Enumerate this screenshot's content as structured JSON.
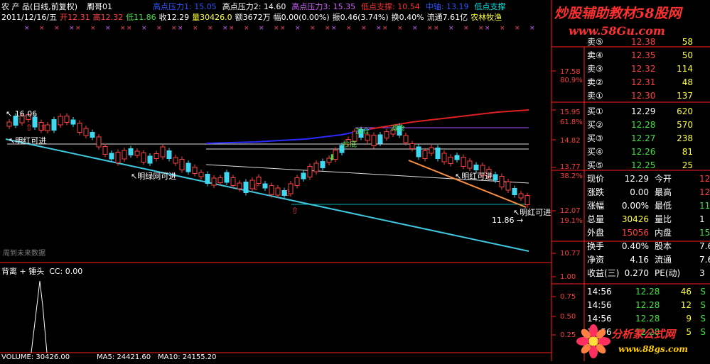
{
  "header": {
    "row1_left": "农 产 品(日线,前复权)",
    "indicator_name": "周哥01",
    "overlay_labels": [
      {
        "text": "高点压力1: 15.05",
        "color": "#2a55ff"
      },
      {
        "text": "高点压力2: 14.60",
        "color": "#ffffff"
      },
      {
        "text": "高点压力3: 15.35",
        "color": "#d060ff"
      },
      {
        "text": "低点支撑: 10.54",
        "color": "#ff3030"
      },
      {
        "text": "中轴: 13.19",
        "color": "#2a55ff"
      },
      {
        "text": "低点支撑",
        "color": "#00e5e5"
      }
    ],
    "row2": [
      {
        "text": "2011/12/16/五",
        "color": "#ffffff"
      },
      {
        "text": "开12.31",
        "color": "#ff4040"
      },
      {
        "text": "高12.32",
        "color": "#ff4040"
      },
      {
        "text": "低11.86",
        "color": "#40e040"
      },
      {
        "text": "收12.29",
        "color": "#ffffff"
      },
      {
        "text": "量30426.0",
        "color": "#ffff40"
      },
      {
        "text": "额3672万",
        "color": "#ffffff"
      },
      {
        "text": "幅0.00(0.00%)",
        "color": "#ffffff"
      },
      {
        "text": "振0.46(3.74%)",
        "color": "#ffffff"
      },
      {
        "text": "换0.40%",
        "color": "#ffffff"
      },
      {
        "text": "流通7.61亿",
        "color": "#ffffff"
      },
      {
        "text": "农林牧渔",
        "color": "#ffff40"
      }
    ]
  },
  "watermark": {
    "title": "炒股辅助教材58股网",
    "url": "www.58Gu.com",
    "logo_text": "分析家公式网",
    "logo_url": "www.88gs.com"
  },
  "chart_annotations": {
    "price_high_label": "16.06",
    "price_low_label": "11.86",
    "buy_hint_1": "明红可进",
    "buy_hint_2": "明绿网可进",
    "buy_hint_3": "明红可进",
    "buy_hint_4": "明红可进",
    "label_jiazhu": "抄底",
    "label_shengji": "加仓",
    "label_xianchu": "减仓",
    "future_data": "周到未来数据"
  },
  "right_axis": {
    "ticks": [
      "17.58",
      "80.9%",
      "15.95",
      "61.8%",
      "14.82",
      "13.77",
      "38.2%",
      "12.07",
      "19.1%",
      "10.77"
    ]
  },
  "lower_panel": {
    "title": "背离 + 锤头",
    "cc_label": "CC: 0.00",
    "ticks": [
      "1.00",
      "0.75",
      "0.50",
      "0.25"
    ],
    "volume_label": "VOLUME: 30426.00",
    "ma5_label": "MA5: 24421.60",
    "ma10_label": "MA10: 24155.20"
  },
  "order_book": {
    "sell": [
      {
        "label": "卖⑤",
        "price": "12.38",
        "vol": "58"
      },
      {
        "label": "卖④",
        "price": "12.35",
        "vol": "50"
      },
      {
        "label": "卖③",
        "price": "12.32",
        "vol": "114"
      },
      {
        "label": "卖②",
        "price": "12.31",
        "vol": "48"
      },
      {
        "label": "卖①",
        "price": "12.30",
        "vol": "137"
      }
    ],
    "buy": [
      {
        "label": "买①",
        "price": "12.29",
        "vol": "620"
      },
      {
        "label": "买②",
        "price": "12.28",
        "vol": "570"
      },
      {
        "label": "买③",
        "price": "12.27",
        "vol": "238"
      },
      {
        "label": "买④",
        "price": "12.26",
        "vol": "81"
      },
      {
        "label": "买⑤",
        "price": "12.25",
        "vol": "25"
      }
    ]
  },
  "stats": [
    {
      "l1": "现价",
      "v1": "12.29",
      "l2": "今开",
      "v2": "12"
    },
    {
      "l1": "涨跌",
      "v1": "0.00",
      "l2": "最高",
      "v2": "12"
    },
    {
      "l1": "涨幅",
      "v1": "0.00%",
      "l2": "最低",
      "v2": "11"
    },
    {
      "l1": "总量",
      "v1": "30426",
      "l2": "量比",
      "v2": "1"
    },
    {
      "l1": "外盘",
      "v1": "15056",
      "l2": "内盘",
      "v2": "15"
    },
    {
      "l1": "换手",
      "v1": "0.40%",
      "l2": "股本",
      "v2": "7.6"
    },
    {
      "l1": "净资",
      "v1": "4.16",
      "l2": "流通",
      "v2": "7.6"
    },
    {
      "l1": "收益(三)",
      "v1": "0.270",
      "l2": "PE(动)",
      "v2": "3"
    }
  ],
  "ticks": [
    {
      "time": "14:56",
      "price": "12.28",
      "vol": "46",
      "side": "S"
    },
    {
      "time": "14:56",
      "price": "12.28",
      "vol": "12",
      "side": "S"
    },
    {
      "time": "14:56",
      "price": "12.28",
      "vol": "9",
      "side": "S"
    },
    {
      "time": "14:56",
      "price": "12.28",
      "vol": "5",
      "side": "S"
    }
  ]
}
